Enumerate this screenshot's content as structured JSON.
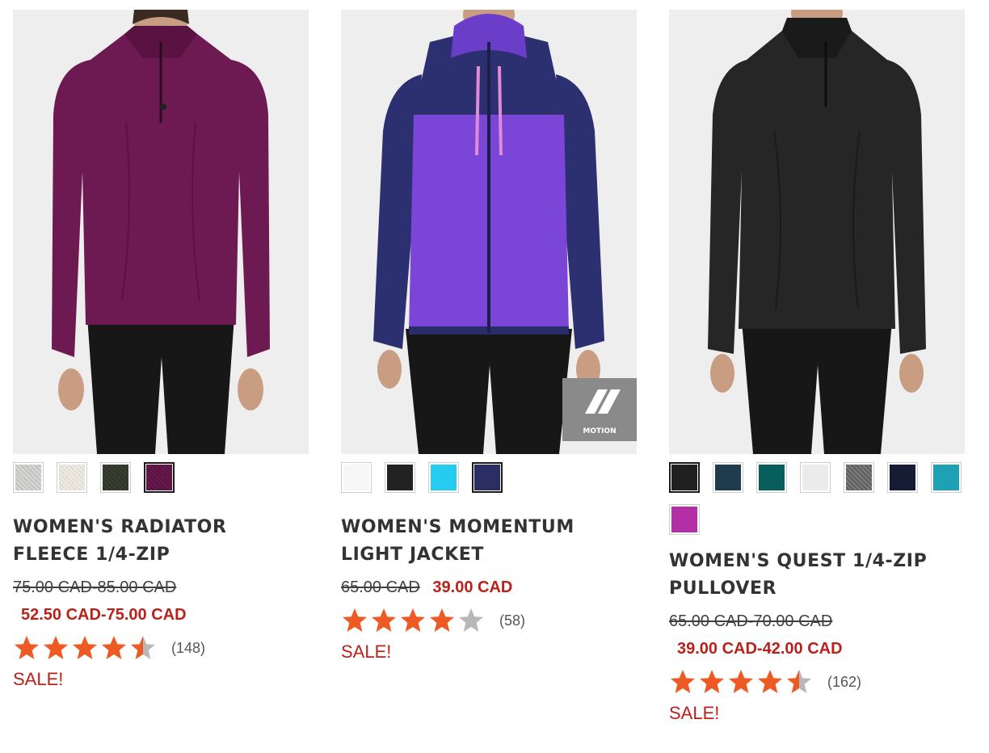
{
  "colors": {
    "sale_red": "#b9211a",
    "star_orange": "#ee5a24",
    "star_gray": "#b8b8b8",
    "title_gray": "#333333"
  },
  "products": [
    {
      "title": "WOMEN'S RADIATOR FLEECE 1/4-ZIP",
      "price_old": "75.00 CAD-85.00 CAD",
      "price_new": "52.50 CAD-75.00 CAD",
      "rating": 4.5,
      "review_count": "(148)",
      "sale_label": "SALE!",
      "swatches": [
        {
          "color": "#d6d6d4",
          "selected": false
        },
        {
          "color": "#efece4",
          "selected": false
        },
        {
          "color": "#3b4232",
          "selected": false
        },
        {
          "color": "#6a1a4f",
          "selected": true
        }
      ]
    },
    {
      "title": "WOMEN'S MOMENTUM LIGHT JACKET",
      "price_old": "65.00 CAD",
      "price_new": "39.00 CAD",
      "rating": 4,
      "review_count": "(58)",
      "sale_label": "SALE!",
      "badge_text": "MOTION",
      "swatches": [
        {
          "color": "#f7f7f7",
          "selected": false
        },
        {
          "color": "#222222",
          "selected": false
        },
        {
          "color": "#25ccf0",
          "selected": false
        },
        {
          "color": "#2b2e62",
          "selected": true
        }
      ]
    },
    {
      "title": "WOMEN'S QUEST 1/4-ZIP PULLOVER",
      "price_old": "65.00 CAD-70.00 CAD",
      "price_new": "39.00 CAD-42.00 CAD",
      "rating": 4.5,
      "review_count": "(162)",
      "sale_label": "SALE!",
      "swatches": [
        {
          "color": "#202020",
          "selected": true
        },
        {
          "color": "#1e3c4d",
          "selected": false
        },
        {
          "color": "#075e5c",
          "selected": false
        },
        {
          "color": "#ebebeb",
          "selected": false
        },
        {
          "color": "#7c7c7c",
          "selected": false
        },
        {
          "color": "#161c33",
          "selected": false
        },
        {
          "color": "#1ea0b5",
          "selected": false
        },
        {
          "color": "#b22fa5",
          "selected": false
        }
      ]
    }
  ]
}
